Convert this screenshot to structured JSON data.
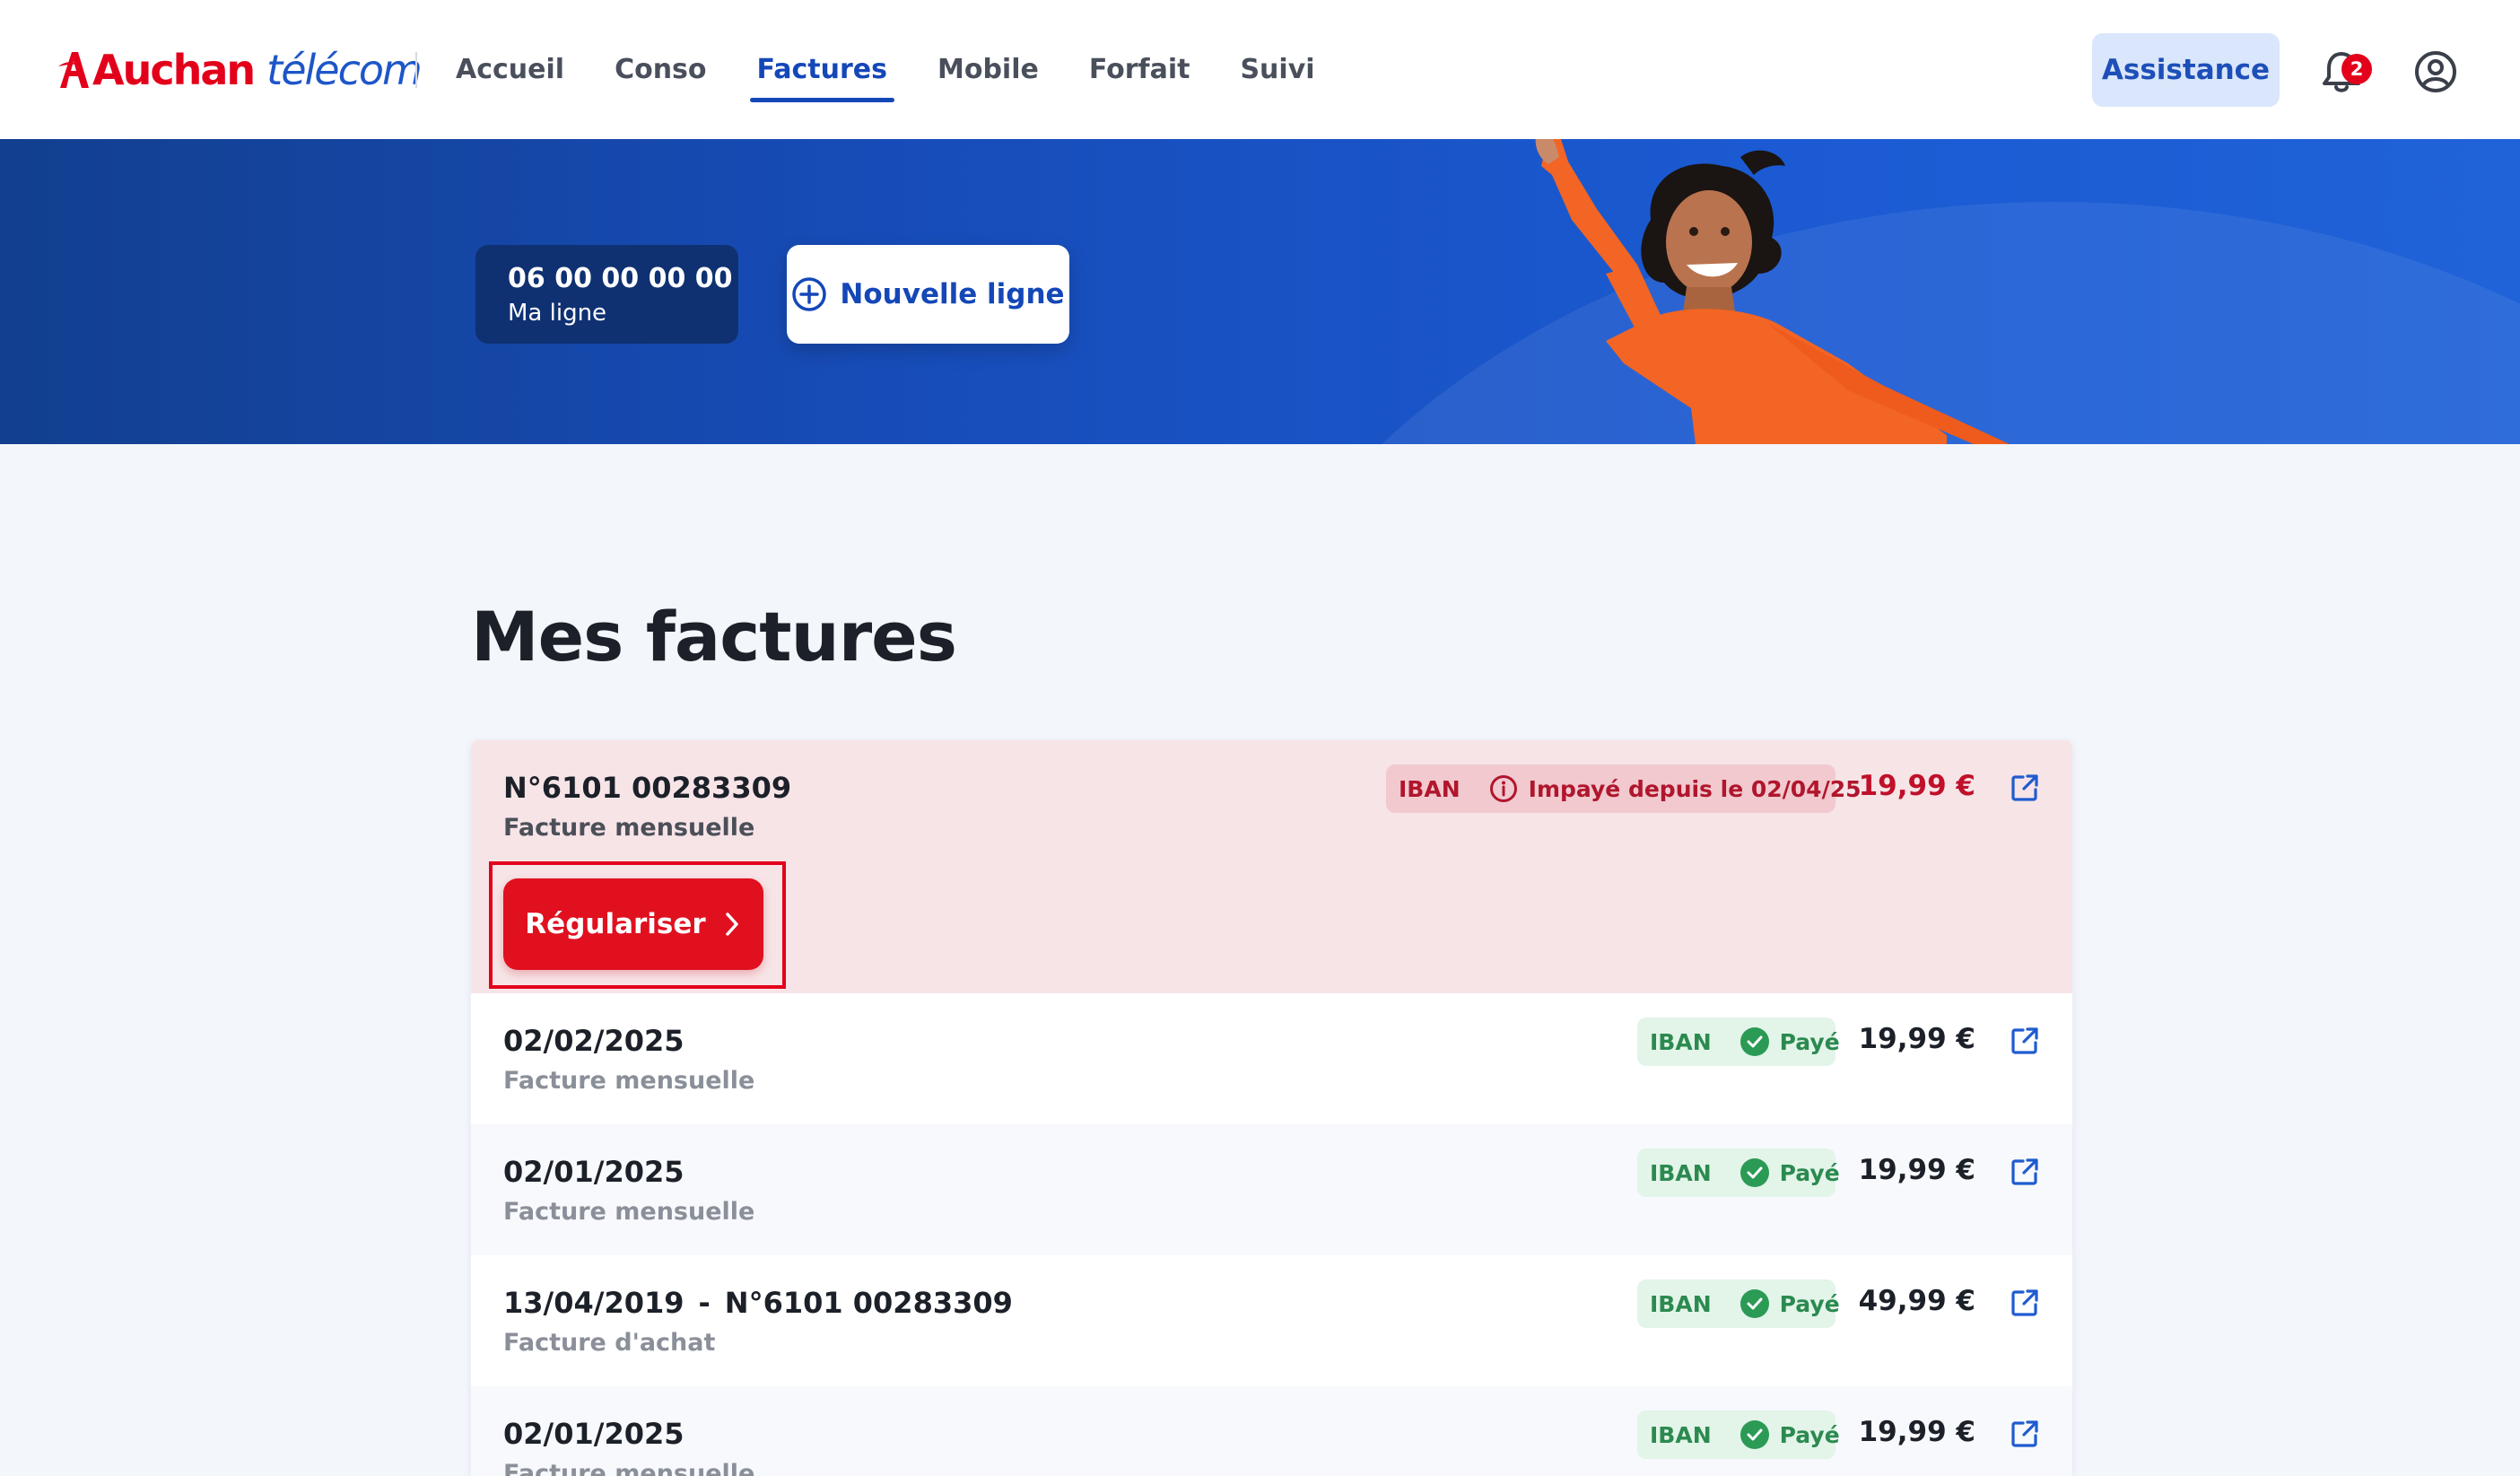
{
  "header": {
    "logo_brand": "Auchan",
    "logo_product": "télécom",
    "nav": [
      "Accueil",
      "Conso",
      "Factures",
      "Mobile",
      "Forfait",
      "Suivi"
    ],
    "active_nav": "Factures",
    "assistance_label": "Assistance",
    "notifications_count": "2",
    "icons": [
      "bell-icon",
      "account-icon"
    ]
  },
  "hero": {
    "line_number": "06 00 00 00 00",
    "line_label": "Ma ligne",
    "new_line_label": "Nouvelle ligne"
  },
  "main": {
    "title": "Mes factures",
    "invoices": [
      {
        "title": "N°6101 00283309",
        "subtitle": "Facture mensuelle",
        "payment_method": "IBAN",
        "status": "Impayé depuis le 02/04/25",
        "amount": "19,99 €",
        "action_label": "Régulariser"
      },
      {
        "title": "02/02/2025",
        "subtitle": "Facture mensuelle",
        "payment_method": "IBAN",
        "status": "Payé",
        "amount": "19,99 €"
      },
      {
        "title": "02/01/2025",
        "subtitle": "Facture mensuelle",
        "payment_method": "IBAN",
        "status": "Payé",
        "amount": "19,99 €"
      },
      {
        "title": "13/04/2019",
        "title_separator": "-",
        "title_extra": "N°6101 00283309",
        "subtitle": "Facture d'achat",
        "payment_method": "IBAN",
        "status": "Payé",
        "amount": "49,99 €"
      },
      {
        "title": "02/01/2025",
        "subtitle": "Facture mensuelle",
        "payment_method": "IBAN",
        "status": "Payé",
        "amount": "19,99 €"
      }
    ]
  },
  "colors": {
    "brand_red": "#e3001b",
    "brand_blue": "#1447b8",
    "paid_green": "#2b8a4f",
    "unpaid_bg": "#f7e4e7"
  }
}
